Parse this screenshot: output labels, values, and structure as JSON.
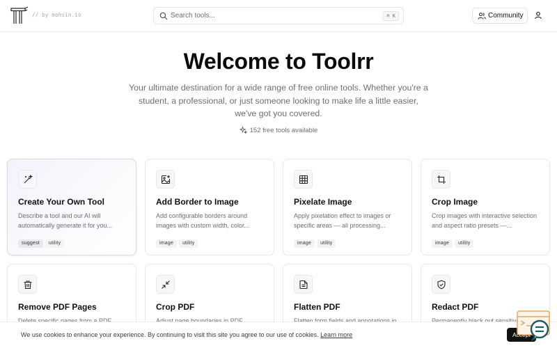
{
  "header": {
    "byline": "// by mohsin.io",
    "search_placeholder": "Search tools...",
    "search_shortcut": "⌘ K",
    "community_label": "Community"
  },
  "hero": {
    "title": "Welcome to Toolrr",
    "subtitle": "Your ultimate destination for a wide range of free online tools. Whether you're a student, a professional, or just someone looking to make life a little easier, we've got you covered.",
    "count": "152 free tools available"
  },
  "tools": [
    {
      "title": "Create Your Own Tool",
      "description": "Describe a tool and our AI will automatically generate it for you...",
      "tags": [
        "suggest",
        "utility"
      ],
      "icon": "magic-wand-icon"
    },
    {
      "title": "Add Border to Image",
      "description": "Add configurable borders around images with custom width, color...",
      "tags": [
        "image",
        "utility"
      ],
      "icon": "image-plus-icon"
    },
    {
      "title": "Pixelate Image",
      "description": "Apply pixelation effect to images or specific areas — all processing...",
      "tags": [
        "image",
        "utility"
      ],
      "icon": "grid-icon"
    },
    {
      "title": "Crop Image",
      "description": "Crop images with interactive selection and aspect ratio presets —...",
      "tags": [
        "image",
        "utility"
      ],
      "icon": "crop-icon"
    },
    {
      "title": "Remove PDF Pages",
      "description": "Delete specific pages from a PDF...",
      "tags": [],
      "icon": "trash-icon"
    },
    {
      "title": "Crop PDF",
      "description": "Adjust page boundaries in PDF...",
      "tags": [],
      "icon": "shrink-icon"
    },
    {
      "title": "Flatten PDF",
      "description": "Flatten form fields and annotations in PDF...",
      "tags": [],
      "icon": "file-text-icon"
    },
    {
      "title": "Redact PDF",
      "description": "Permanently black out sensitive content...",
      "tags": [],
      "icon": "shield-check-icon"
    }
  ],
  "cookie": {
    "text": "We use cookies to enhance your experience. By continuing to visit this site you agree to our use of cookies.",
    "link": "Learn more",
    "accept": "Accept"
  }
}
